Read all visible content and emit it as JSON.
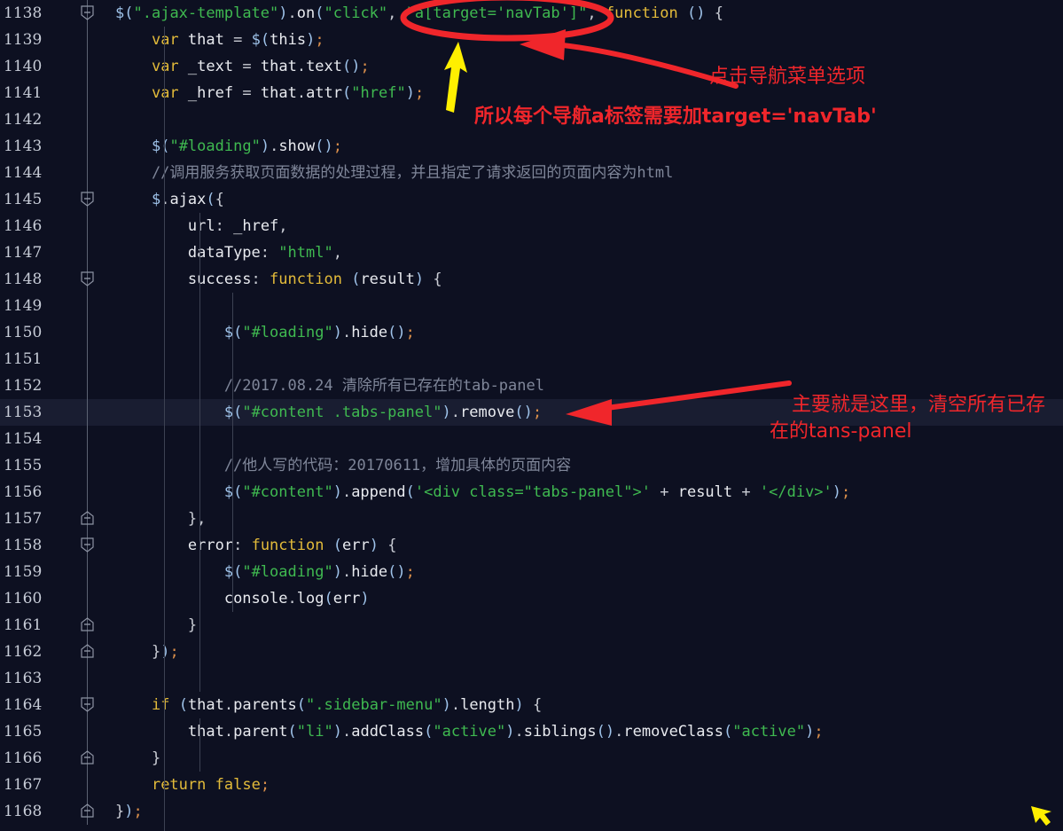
{
  "editor": {
    "theme_background": "#0d1021",
    "current_line_background": "#191d31",
    "current_line_number": 1153,
    "first_line_number": 1138,
    "lines": [
      {
        "num": "1138",
        "fold": "collapse",
        "code": "$(\".ajax-template\").on(\"click\", \"a[target='navTab']\", function () {"
      },
      {
        "num": "1139",
        "fold": "none",
        "code": "    var that = $(this);"
      },
      {
        "num": "1140",
        "fold": "none",
        "code": "    var _text = that.text();"
      },
      {
        "num": "1141",
        "fold": "none",
        "code": "    var _href = that.attr(\"href\");"
      },
      {
        "num": "1142",
        "fold": "none",
        "code": ""
      },
      {
        "num": "1143",
        "fold": "none",
        "code": "    $(\"#loading\").show();"
      },
      {
        "num": "1144",
        "fold": "none",
        "code": "    //调用服务获取页面数据的处理过程，并且指定了请求返回的页面内容为html"
      },
      {
        "num": "1145",
        "fold": "collapse",
        "code": "    $.ajax({"
      },
      {
        "num": "1146",
        "fold": "none",
        "code": "        url: _href,"
      },
      {
        "num": "1147",
        "fold": "none",
        "code": "        dataType: \"html\","
      },
      {
        "num": "1148",
        "fold": "collapse",
        "code": "        success: function (result) {"
      },
      {
        "num": "1149",
        "fold": "none",
        "code": ""
      },
      {
        "num": "1150",
        "fold": "none",
        "code": "            $(\"#loading\").hide();"
      },
      {
        "num": "1151",
        "fold": "none",
        "code": ""
      },
      {
        "num": "1152",
        "fold": "none",
        "code": "            //2017.08.24 清除所有已存在的tab-panel"
      },
      {
        "num": "1153",
        "fold": "none",
        "code": "            $(\"#content .tabs-panel\").remove();"
      },
      {
        "num": "1154",
        "fold": "none",
        "code": ""
      },
      {
        "num": "1155",
        "fold": "none",
        "code": "            //他人写的代码：20170611，增加具体的页面内容"
      },
      {
        "num": "1156",
        "fold": "none",
        "code": "            $(\"#content\").append('<div class=\"tabs-panel\">' + result + '</div>');"
      },
      {
        "num": "1157",
        "fold": "expand",
        "code": "        },"
      },
      {
        "num": "1158",
        "fold": "collapse",
        "code": "        error: function (err) {"
      },
      {
        "num": "1159",
        "fold": "none",
        "code": "            $(\"#loading\").hide();"
      },
      {
        "num": "1160",
        "fold": "none",
        "code": "            console.log(err)"
      },
      {
        "num": "1161",
        "fold": "expand",
        "code": "        }"
      },
      {
        "num": "1162",
        "fold": "expand",
        "code": "    });"
      },
      {
        "num": "1163",
        "fold": "none",
        "code": ""
      },
      {
        "num": "1164",
        "fold": "collapse",
        "code": "    if (that.parents(\".sidebar-menu\").length) {"
      },
      {
        "num": "1165",
        "fold": "none",
        "code": "        that.parent(\"li\").addClass(\"active\").siblings().removeClass(\"active\");"
      },
      {
        "num": "1166",
        "fold": "expand",
        "code": "    }"
      },
      {
        "num": "1167",
        "fold": "none",
        "code": "    return false;"
      },
      {
        "num": "1168",
        "fold": "expand",
        "code": "});"
      }
    ]
  },
  "annotations": {
    "color": "#f0262b",
    "highlight_color": "#ffef00",
    "ellipse": {
      "name": "red-ellipse-around-selector",
      "target_text": "a[target='navTab']"
    },
    "notes": [
      {
        "id": "note-click-nav-menu",
        "text": "点击导航菜单选项"
      },
      {
        "id": "note-add-target-attr",
        "text": "所以每个导航a标签需要加target='navTab'"
      },
      {
        "id": "note-main-point-line1",
        "text": "主要就是这里，清空所有已存"
      },
      {
        "id": "note-main-point-line2",
        "text": "在的tans-panel"
      }
    ],
    "arrows": [
      {
        "id": "red-arrow-into-ellipse",
        "color": "#f0262b"
      },
      {
        "id": "red-arrow-to-line-1153",
        "color": "#f0262b"
      },
      {
        "id": "yellow-arrow-up",
        "color": "#ffef00"
      },
      {
        "id": "yellow-cursor-arrow",
        "color": "#ffef00"
      }
    ]
  }
}
